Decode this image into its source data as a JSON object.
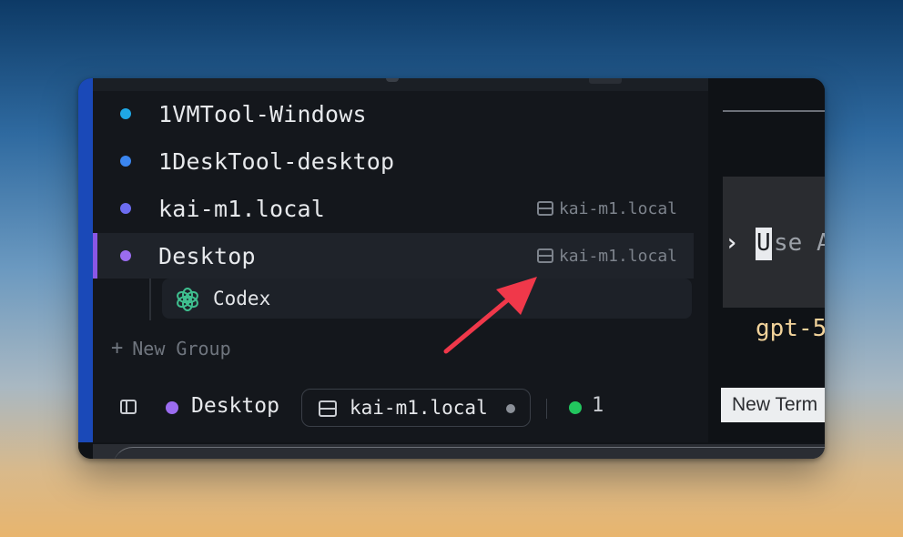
{
  "colors": {
    "accent_selected": "#8a57e6",
    "dot_1vmtool": "#1fa8e6",
    "dot_1desktool": "#3b86f0",
    "dot_kai": "#6c6cf0",
    "dot_desktop": "#9b6cf0",
    "status_online": "#22c55e",
    "annotation_arrow": "#f0384a"
  },
  "sidebar": {
    "items": [
      {
        "label": "1VMTool-Windows",
        "host": ""
      },
      {
        "label": "1DeskTool-desktop",
        "host": ""
      },
      {
        "label": "kai-m1.local",
        "host": "kai-m1.local"
      },
      {
        "label": "Desktop",
        "host": "kai-m1.local",
        "selected": true
      }
    ],
    "child": {
      "label": "Codex",
      "icon": "openai-icon"
    },
    "new_group_label": "New Group"
  },
  "statusbar": {
    "workspace_label": "Desktop",
    "host_label": "kai-m1.local",
    "count": "1"
  },
  "terminal": {
    "prompt_char": "›",
    "cursor_char": "U",
    "input_hint": "se A",
    "model_text": "gpt-5",
    "new_terminal_label": "New Term"
  }
}
